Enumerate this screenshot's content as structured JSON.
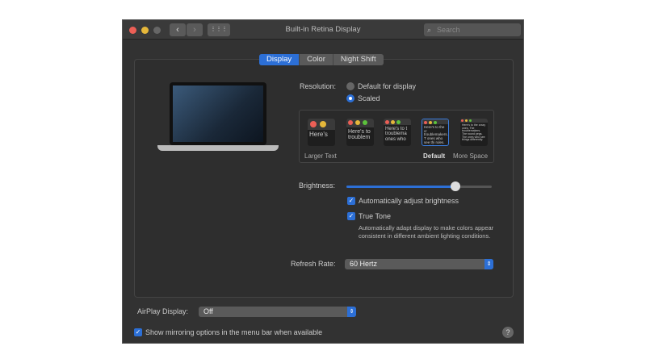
{
  "window": {
    "title": "Built-in Retina Display",
    "search_placeholder": "Search",
    "back": "‹",
    "forward": "›",
    "grid": "⋮⋮⋮"
  },
  "tabs": [
    {
      "label": "Display",
      "active": true
    },
    {
      "label": "Color",
      "active": false
    },
    {
      "label": "Night Shift",
      "active": false
    }
  ],
  "resolution": {
    "label": "Resolution:",
    "options": [
      {
        "label": "Default for display",
        "selected": false
      },
      {
        "label": "Scaled",
        "selected": true
      }
    ]
  },
  "scaled_options": {
    "larger_text": "Larger Text",
    "default": "Default",
    "more_space": "More Space",
    "selected_index": 3,
    "previews": [
      "Here's",
      "Here's to troublem",
      "Here's to t troublema ones who",
      "Here's to the cr troublemakers. T ones who see thi rules. And they",
      "Here's to the crazy ones. The troublemakers. The round pegs. The ones who see things differently."
    ]
  },
  "brightness": {
    "label": "Brightness:",
    "value": 0.75
  },
  "auto_brightness": {
    "label": "Automatically adjust brightness",
    "checked": true
  },
  "true_tone": {
    "label": "True Tone",
    "checked": true,
    "description": "Automatically adapt display to make colors appear consistent in different ambient lighting conditions."
  },
  "refresh_rate": {
    "label": "Refresh Rate:",
    "value": "60 Hertz"
  },
  "airplay": {
    "label": "AirPlay Display:",
    "value": "Off"
  },
  "mirroring": {
    "label": "Show mirroring options in the menu bar when available",
    "checked": true
  },
  "help": "?",
  "colors": {
    "accent": "#2c6fd6",
    "close": "#ec5f56",
    "minimize": "#e5b73a"
  }
}
